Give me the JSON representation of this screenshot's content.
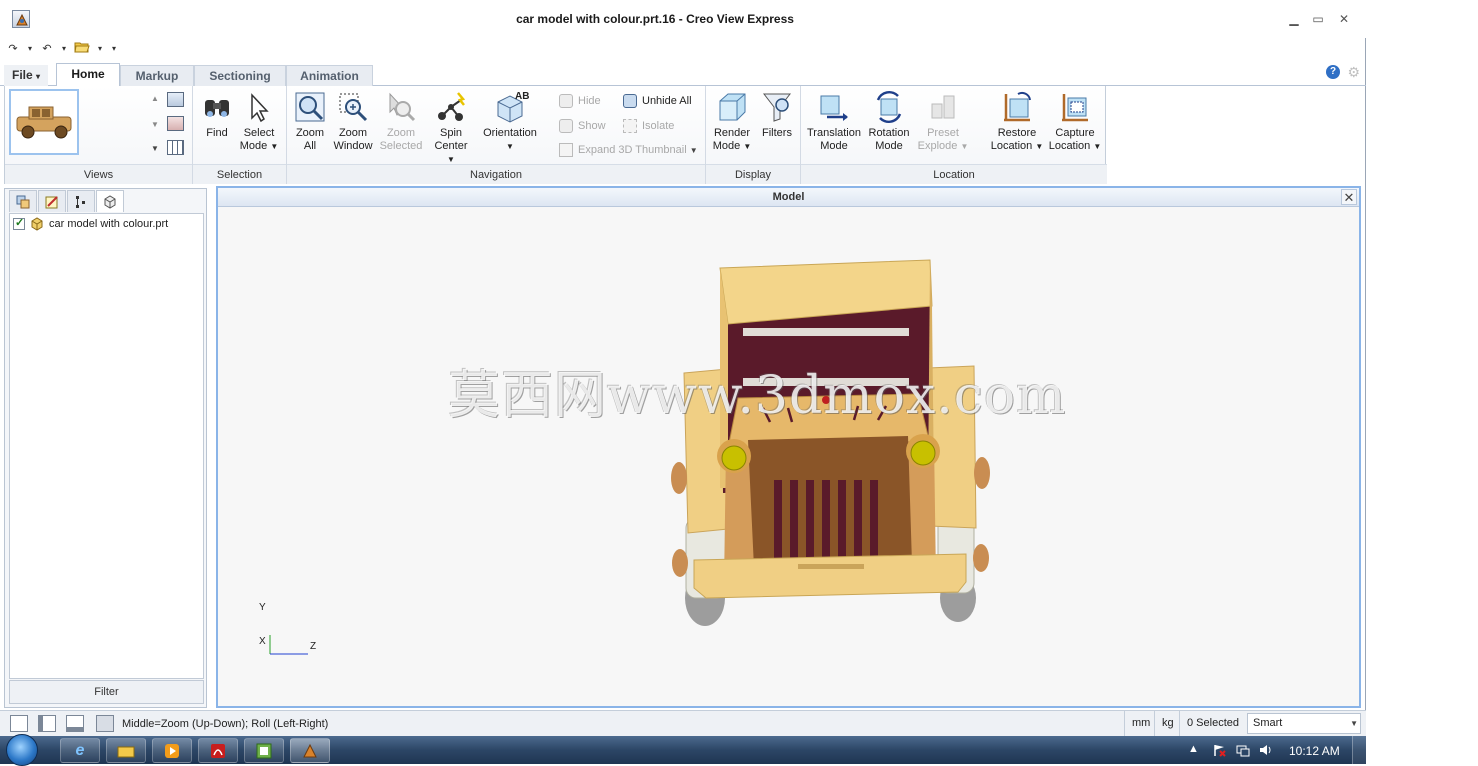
{
  "window": {
    "title": "car model with colour.prt.16 - Creo View Express",
    "minimize": "▁",
    "maximize": "▭",
    "close": "✕"
  },
  "quick_access": {
    "redo": "↷",
    "undo": "↶",
    "more": "▾"
  },
  "tabs": [
    {
      "label": "File",
      "active": false
    },
    {
      "label": "Home",
      "active": true
    },
    {
      "label": "Markup",
      "active": false
    },
    {
      "label": "Sectioning",
      "active": false
    },
    {
      "label": "Animation",
      "active": false
    }
  ],
  "help_label": "?",
  "ribbon": {
    "views": {
      "label": "Views"
    },
    "selection": {
      "label": "Selection",
      "find": "Find",
      "select_mode_1": "Select",
      "select_mode_2": "Mode"
    },
    "navigation": {
      "label": "Navigation",
      "zoom_all_1": "Zoom",
      "zoom_all_2": "All",
      "zoom_window_1": "Zoom",
      "zoom_window_2": "Window",
      "zoom_selected_1": "Zoom",
      "zoom_selected_2": "Selected",
      "spin_center_1": "Spin",
      "spin_center_2": "Center",
      "orientation": "Orientation",
      "orientation_badge": "AB",
      "hide": "Hide",
      "unhide_all": "Unhide All",
      "show": "Show",
      "isolate": "Isolate",
      "expand_thumbnail": "Expand 3D Thumbnail"
    },
    "display": {
      "label": "Display",
      "render_mode_1": "Render",
      "render_mode_2": "Mode",
      "filters": "Filters"
    },
    "location": {
      "label": "Location",
      "translation_mode_1": "Translation",
      "translation_mode_2": "Mode",
      "rotation_mode_1": "Rotation",
      "rotation_mode_2": "Mode",
      "preset_explode_1": "Preset",
      "preset_explode_2": "Explode",
      "restore_location_1": "Restore",
      "restore_location_2": "Location",
      "capture_location_1": "Capture",
      "capture_location_2": "Location"
    }
  },
  "tree": {
    "items": [
      {
        "label": "car model with colour.prt",
        "checked": true
      }
    ],
    "filter_label": "Filter"
  },
  "viewport": {
    "title": "Model",
    "close": "✕",
    "watermark": "莫西网www.3dmox.com",
    "axes": {
      "y": "Y",
      "x": "X",
      "z": "Z"
    }
  },
  "status": {
    "message": "Middle=Zoom (Up-Down); Roll (Left-Right)",
    "unit_length": "mm",
    "unit_mass": "kg",
    "selected": "0 Selected",
    "selection_filter": "Smart"
  },
  "taskbar": {
    "time": "10:12 AM",
    "tray_arrow": "▲"
  },
  "colors": {
    "accent": "#2f6fc5",
    "viewport_border": "#8ab4e8",
    "car_body": "#f2d48a",
    "car_trim": "#5a1a2a",
    "headlight": "#c8c000"
  }
}
